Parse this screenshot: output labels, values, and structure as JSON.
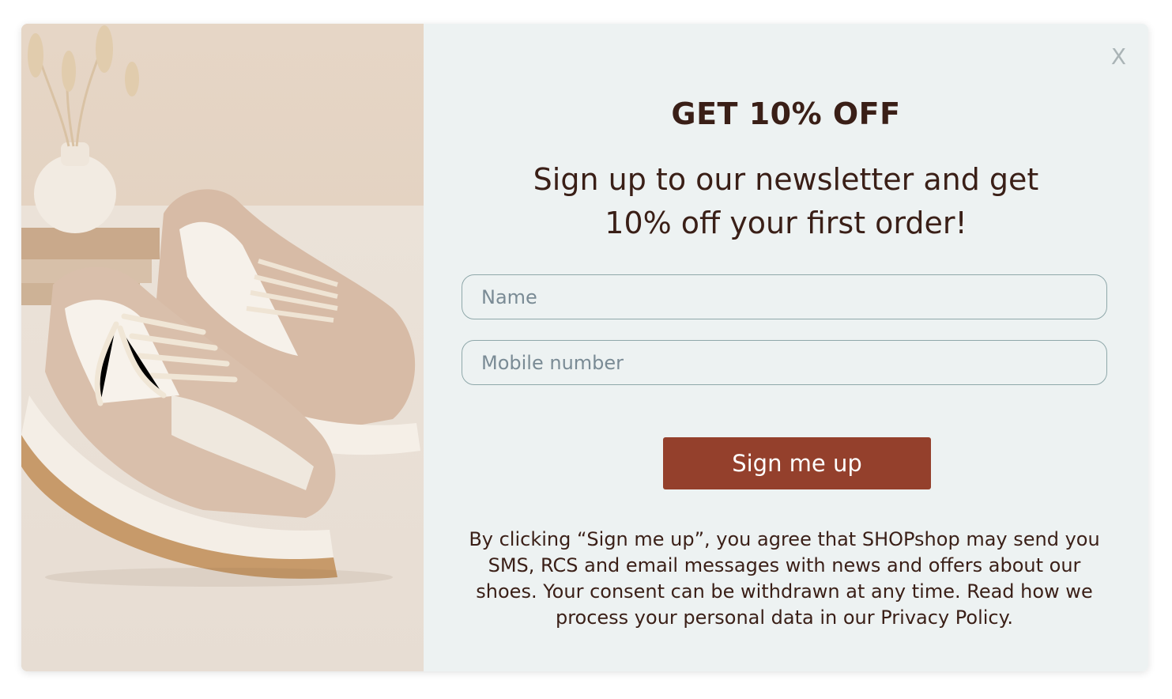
{
  "popup": {
    "close_label": "X",
    "heading": "GET 10% OFF",
    "subheading": "Sign up to our newsletter and get 10% off your first order!",
    "name_placeholder": "Name",
    "mobile_placeholder": "Mobile number",
    "submit_label": "Sign me up",
    "legal_text": "By clicking “Sign me up”, you agree that SHOPshop may send you SMS, RCS and email messages with news and offers about our shoes. Your consent can be withdrawn at any time. Read how we process your personal data in our Privacy Policy."
  },
  "hero_image": {
    "subject": "sneakers-photo"
  },
  "colors": {
    "panel_bg": "#edf2f2",
    "text_dark": "#3a1f17",
    "button_bg": "#94402c",
    "input_border": "#8fa8aa",
    "close_icon": "#aab4b6"
  }
}
